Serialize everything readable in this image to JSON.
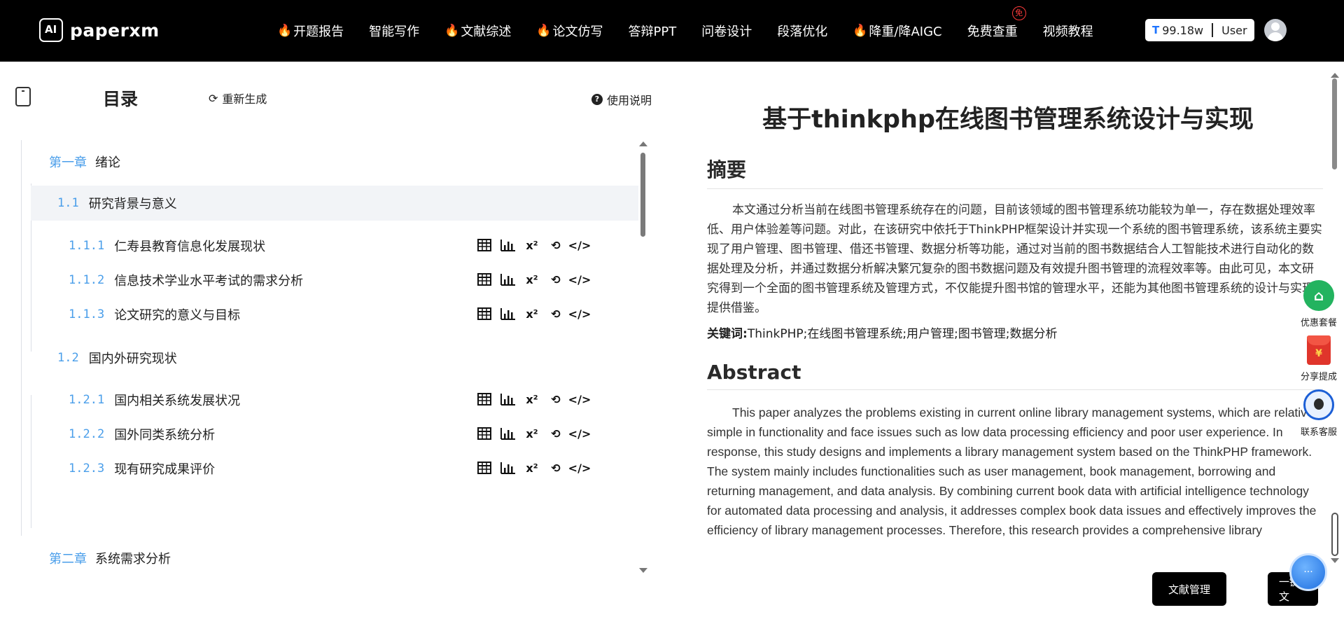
{
  "app": {
    "logo_text": "paperxm"
  },
  "nav": {
    "items": [
      {
        "label": "开题报告",
        "hot": true
      },
      {
        "label": "智能写作",
        "hot": false
      },
      {
        "label": "文献综述",
        "hot": true
      },
      {
        "label": "论文仿写",
        "hot": true
      },
      {
        "label": "答辩PPT",
        "hot": false
      },
      {
        "label": "问卷设计",
        "hot": false
      },
      {
        "label": "段落优化",
        "hot": false
      },
      {
        "label": "降重/降AIGC",
        "hot": true
      },
      {
        "label": "免费查重",
        "hot": false,
        "badge": "免"
      },
      {
        "label": "视频教程",
        "hot": false
      }
    ],
    "tokens_icon": "T",
    "tokens": "99.18w",
    "user": "User"
  },
  "toc": {
    "title": "目录",
    "regenerate": "重新生成",
    "help": "使用说明",
    "chapter1": {
      "num": "第一章",
      "title": "绪论"
    },
    "sec1_1": {
      "num": "1.1",
      "title": "研究背景与意义"
    },
    "sub1_1_1": {
      "num": "1.1.1",
      "title": "仁寿县教育信息化发展现状"
    },
    "sub1_1_2": {
      "num": "1.1.2",
      "title": "信息技术学业水平考试的需求分析"
    },
    "sub1_1_3": {
      "num": "1.1.3",
      "title": "论文研究的意义与目标"
    },
    "sec1_2": {
      "num": "1.2",
      "title": "国内外研究现状"
    },
    "sub1_2_1": {
      "num": "1.2.1",
      "title": "国内相关系统发展状况"
    },
    "sub1_2_2": {
      "num": "1.2.2",
      "title": "国外同类系统分析"
    },
    "sub1_2_3": {
      "num": "1.2.3",
      "title": "现有研究成果评价"
    },
    "chapter2": {
      "num": "第二章",
      "title": "系统需求分析"
    },
    "tool_icons": [
      "table-icon",
      "chart-icon",
      "formula-icon",
      "rewrite-icon",
      "code-icon"
    ]
  },
  "doc": {
    "title": "基于thinkphp在线图书管理系统设计与实现",
    "abstract_heading": "摘要",
    "abstract_text": "本文通过分析当前在线图书管理系统存在的问题，目前该领域的图书管理系统功能较为单一，存在数据处理效率低、用户体验差等问题。对此，在该研究中依托于ThinkPHP框架设计并实现一个系统的图书管理系统，该系统主要实现了用户管理、图书管理、借还书管理、数据分析等功能，通过对当前的图书数据结合人工智能技术进行自动化的数据处理及分析，并通过数据分析解决繁冗复杂的图书数据问题及有效提升图书管理的流程效率等。由此可见，本文研究得到一个全面的图书管理系统及管理方式，不仅能提升图书馆的管理水平，还能为其他图书管理系统的设计与实现提供借鉴。",
    "keywords_label": "关键词:",
    "keywords": "ThinkPHP;在线图书管理系统;用户管理;图书管理;数据分析",
    "abstract_en_heading": "Abstract",
    "abstract_en_text": "This paper analyzes the problems existing in current online library management systems, which are relatively simple in functionality and face issues such as low data processing efficiency and poor user experience. In response, this study designs and implements a library management system based on the ThinkPHP framework. The system mainly includes functionalities such as user management, book management, borrowing and returning management, and data analysis. By combining current book data with artificial intelligence technology for automated data processing and analysis, it addresses complex book data issues and effectively improves the efficiency of library management processes. Therefore, this research provides a comprehensive library"
  },
  "side": {
    "offer": "优惠套餐",
    "share": "分享提成",
    "service": "联系客服",
    "redpack_symbol": "¥"
  },
  "buttons": {
    "literature": "文献管理",
    "one_click": "一键全文"
  },
  "colors": {
    "accent": "#4a9eea",
    "topbar": "#000000",
    "hot": "#ff2d2d"
  }
}
